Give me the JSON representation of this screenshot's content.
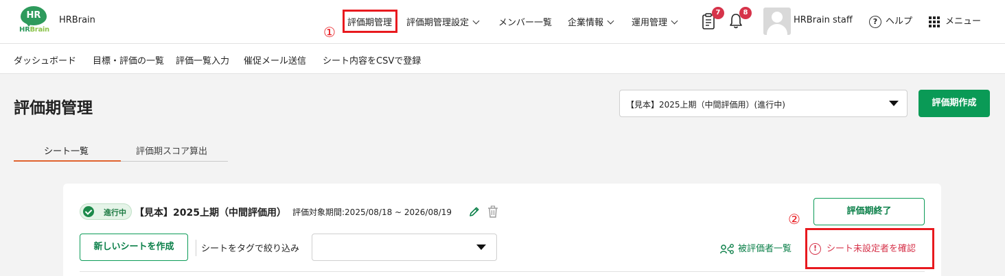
{
  "header": {
    "logo_text": "HR",
    "logo_sub_a": "HR",
    "logo_sub_b": "Brain",
    "brand_name": "HRBrain",
    "nav": [
      {
        "label": "評価期管理",
        "dropdown": false
      },
      {
        "label": "評価期管理設定",
        "dropdown": true
      },
      {
        "label": "メンバー一覧",
        "dropdown": false
      },
      {
        "label": "企業情報",
        "dropdown": true
      },
      {
        "label": "運用管理",
        "dropdown": true
      }
    ],
    "clipboard_badge": "7",
    "bell_badge": "8",
    "user_name": "HRBrain staff",
    "help_label": "ヘルプ",
    "help_glyph": "?",
    "menu_label": "メニュー"
  },
  "annotations": {
    "one": "①",
    "two": "②"
  },
  "sub_nav": [
    "ダッシュボード",
    "目標・評価の一覧",
    "評価一覧入力",
    "催促メール送信",
    "シート内容をCSVで登録"
  ],
  "page": {
    "title": "評価期管理",
    "period_select_value": "【見本】2025上期（中間評価用）(進行中)",
    "create_period_label": "評価期作成"
  },
  "tabs": [
    {
      "label": "シート一覧",
      "active": true
    },
    {
      "label": "評価期スコア算出",
      "active": false
    }
  ],
  "card": {
    "status": "進行中",
    "title": "【見本】2025上期（中間評価用）",
    "period": "評価対象期間:2025/08/18 ~ 2026/08/19",
    "end_button": "評価期終了",
    "new_sheet_button": "新しいシートを作成",
    "filter_label": "シートをタグで絞り込み",
    "tag_select_value": "",
    "evaluatee_link": "被評価者一覧",
    "confirm_link": "シート未設定者を確認",
    "warn_glyph": "!"
  },
  "colors": {
    "brand_green": "#0a9a56",
    "alert_red": "#d6334a",
    "annotation_red": "#e8191e",
    "tab_active": "#e0622c"
  }
}
